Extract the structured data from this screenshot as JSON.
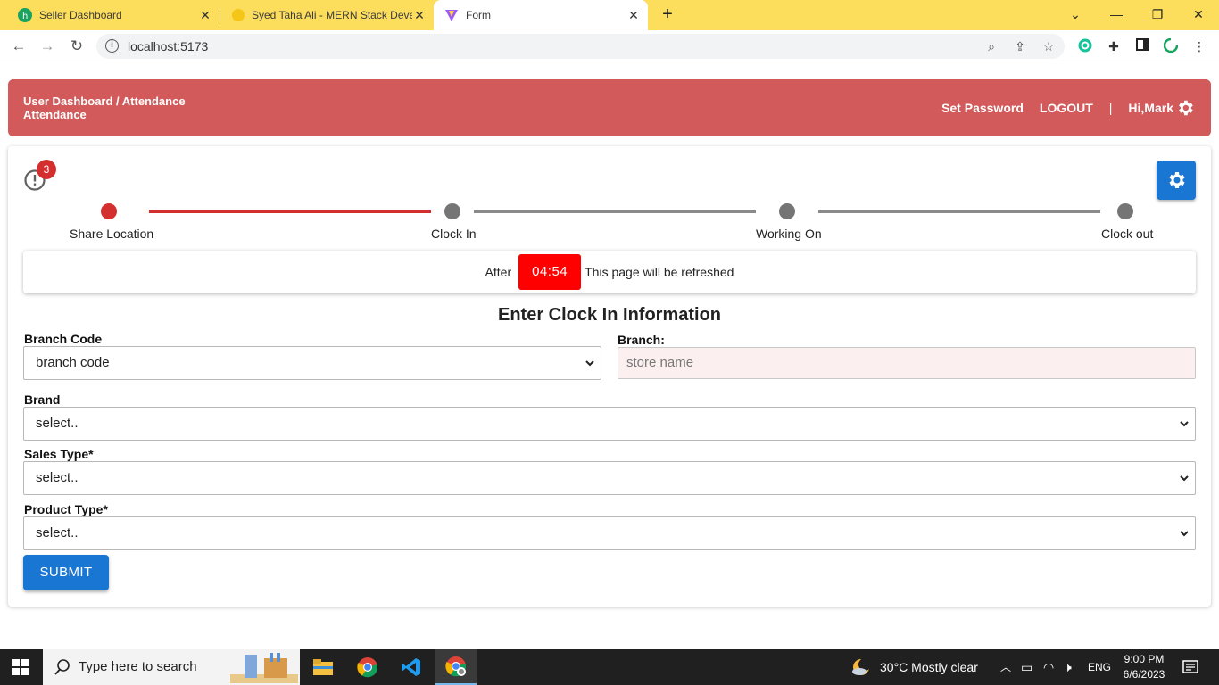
{
  "browser": {
    "tabs": [
      {
        "title": "Seller Dashboard",
        "favicon_color": "#1aa260"
      },
      {
        "title": "Syed Taha Ali - MERN Stack Deve",
        "favicon_color": "#f5c518"
      },
      {
        "title": "Form",
        "favicon_color": "#9b59ff"
      }
    ],
    "url": "localhost:5173"
  },
  "header": {
    "breadcrumb": "User Dashboard / Attendance",
    "page": "Attendance",
    "set_password": "Set Password",
    "logout": "LOGOUT",
    "separator": "|",
    "greeting": "Hi,Mark"
  },
  "notifications": {
    "count": "3"
  },
  "stepper": {
    "steps": [
      "Share Location",
      "Clock In",
      "Working On",
      "Clock out"
    ],
    "active_index": 0,
    "active_color": "#d32f2f"
  },
  "refresh": {
    "prefix": "After",
    "timer": "04:54",
    "suffix": "This page will be refreshed"
  },
  "form": {
    "title": "Enter Clock In Information",
    "branch_code_label": "Branch Code",
    "branch_code_value": "branch code",
    "branch_label": "Branch:",
    "branch_placeholder": "store name",
    "brand_label": "Brand",
    "brand_value": "select..",
    "sales_type_label": "Sales Type*",
    "sales_type_value": "select..",
    "product_type_label": "Product Type*",
    "product_type_value": "select..",
    "submit": "SUBMIT"
  },
  "taskbar": {
    "search_placeholder": "Type here to search",
    "weather": "30°C  Mostly clear",
    "lang": "ENG",
    "time": "9:00 PM",
    "date": "6/6/2023"
  },
  "colors": {
    "header_bg": "#d25a5a",
    "primary": "#1976d2",
    "timer_bg": "#ff0000",
    "badge": "#d32f2f"
  }
}
